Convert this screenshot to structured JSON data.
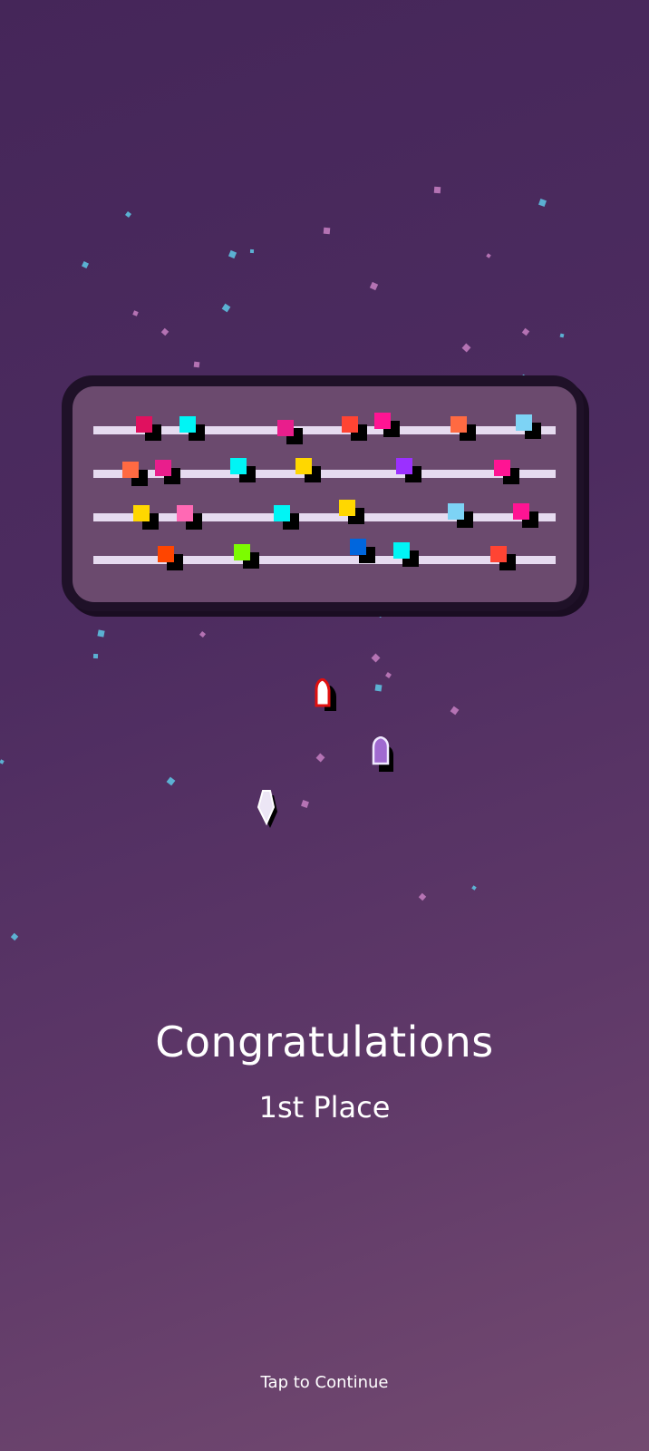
{
  "screen": {
    "title": "Congratulations",
    "placement": "1st Place",
    "continue_label": "Tap to Continue"
  },
  "colors": {
    "background_top": "#452659",
    "background_bottom": "#734a70",
    "board_frame": "#1f1128",
    "board_surface": "#6b4a6e",
    "lane": "#e6dbf0",
    "confetti_pink": "#c77fc2",
    "confetti_cyan": "#5ec8e6"
  },
  "board": {
    "lanes": 4,
    "block_colors": {
      "lane_1": [
        "#e0115f",
        "#00f5f5",
        "#e91e8c",
        "#ff4433",
        "#ff1493",
        "#ff6a42",
        "#7dd3f5"
      ],
      "lane_2": [
        "#ff6a42",
        "#e91e8c",
        "#00f5f5",
        "#ffd700",
        "#9b30ff",
        "#ff1493"
      ],
      "lane_3": [
        "#ffd700",
        "#ff69b4",
        "#00f5f5",
        "#ffd700",
        "#7dd3f5",
        "#ff1493"
      ],
      "lane_4": [
        "#ff4500",
        "#7cfc00",
        "#0066dd",
        "#00f5f5",
        "#ff4433"
      ]
    }
  },
  "pieces": [
    {
      "name": "red-outline-pawn",
      "fill": "#ffffff",
      "stroke": "#e01010"
    },
    {
      "name": "purple-pawn",
      "fill": "#a06ad0",
      "stroke": "#ffffff"
    },
    {
      "name": "white-gem",
      "fill": "#ece6f5",
      "stroke": "#ffffff"
    }
  ]
}
